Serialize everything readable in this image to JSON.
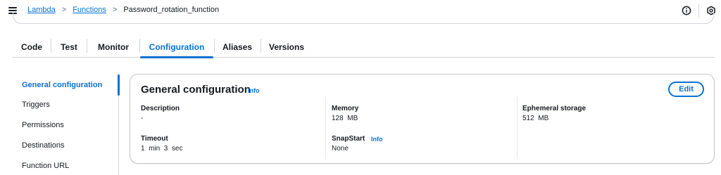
{
  "breadcrumb": {
    "items": [
      "Lambda",
      "Functions",
      "Password_rotation_function"
    ],
    "separator": ">"
  },
  "header_icons": [
    "info-circle-icon",
    "settings-icon"
  ],
  "tabs": [
    {
      "label": "Code"
    },
    {
      "label": "Test"
    },
    {
      "label": "Monitor"
    },
    {
      "label": "Configuration",
      "active": true
    },
    {
      "label": "Aliases"
    },
    {
      "label": "Versions"
    }
  ],
  "sidebar": {
    "items": [
      {
        "label": "General configuration",
        "active": true
      },
      {
        "label": "Triggers"
      },
      {
        "label": "Permissions"
      },
      {
        "label": "Destinations"
      },
      {
        "label": "Function URL"
      }
    ]
  },
  "panel": {
    "title": "General configuration",
    "info_label": "Info",
    "edit_label": "Edit",
    "fields": {
      "description": {
        "label": "Description",
        "value": "-"
      },
      "timeout": {
        "label": "Timeout",
        "value": "1  min  3  sec"
      },
      "memory": {
        "label": "Memory",
        "value": "128  MB"
      },
      "snapstart": {
        "label": "SnapStart",
        "info_label": "Info",
        "value": "None"
      },
      "ephemeral_storage": {
        "label": "Ephemeral storage",
        "value": "512  MB"
      }
    }
  },
  "colors": {
    "accent": "#0972d3",
    "text": "#16191f",
    "border": "#d1d5db"
  }
}
